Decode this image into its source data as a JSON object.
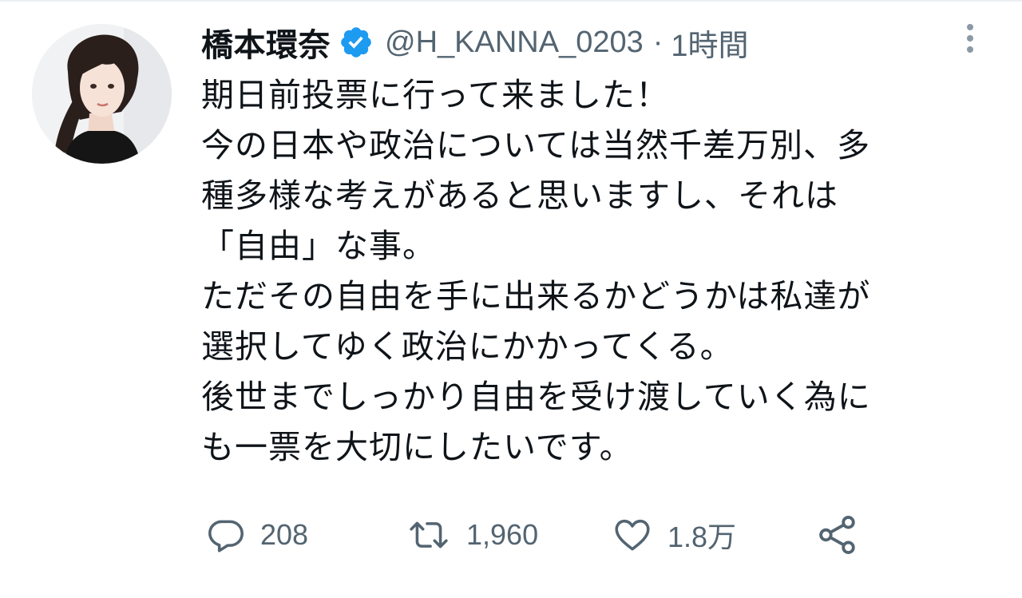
{
  "tweet": {
    "display_name": "橋本環奈",
    "handle": "@H_KANNA_0203",
    "separator": "·",
    "time": "1時間",
    "text_lines": [
      "期日前投票に行って来ました！",
      "今の日本や政治については当然千差万別、多",
      "種多様な考えがあると思いますし、それは",
      "「自由」な事。",
      "ただその自由を手に出来るかどうかは私達が",
      "選択してゆく政治にかかってくる。",
      "後世までしっかり自由を受け渡していく為に",
      "も一票を大切にしたいです。"
    ]
  },
  "actions": {
    "reply": {
      "icon": "reply-icon",
      "count": "208"
    },
    "retweet": {
      "icon": "retweet-icon",
      "count": "1,960"
    },
    "like": {
      "icon": "heart-icon",
      "count": "1.8万"
    },
    "share": {
      "icon": "share-icon"
    }
  },
  "colors": {
    "text": "#0f1419",
    "secondary": "#536471",
    "verified": "#1d9bf0"
  }
}
